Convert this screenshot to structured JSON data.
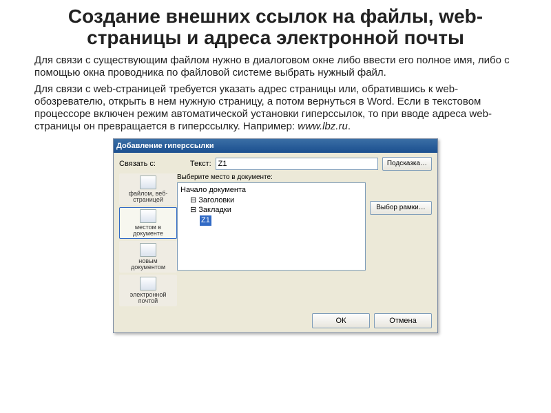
{
  "title": "Создание внешних ссылок на файлы, web-страницы и адреса электронной почты",
  "para1": "Для связи с существующим файлом нужно в диалоговом окне либо ввести его полное имя, либо с помощью окна проводника по файловой системе выбрать нужный файл.",
  "para2_a": "Для связи с web-страницей требуется указать адрес страницы или, обратившись к web-обозревателю, открыть в нем нужную страницу, а потом вернуться в Word. Если в текстовом процессоре включен режим автоматической установки гиперссылок, то при вводе адреса web-страницы он превращается в гиперссылку. Например: ",
  "para2_example": "www.lbz.ru",
  "para2_b": ".",
  "dlg": {
    "title": "Добавление гиперссылки",
    "link_to": "Связать с:",
    "text_lbl": "Текст:",
    "text_val": "Z1",
    "hint_btn": "Подсказка…",
    "center_hdr": "Выберите место в документе:",
    "tree": {
      "root": "Начало документа",
      "n1": "Заголовки",
      "n2": "Закладки",
      "leaf": "Z1"
    },
    "frame_btn": "Выбор рамки…",
    "ok": "ОК",
    "cancel": "Отмена",
    "side": {
      "s0": "файлом, веб-страницей",
      "s1": "местом в документе",
      "s2": "новым документом",
      "s3": "электронной почтой"
    }
  }
}
